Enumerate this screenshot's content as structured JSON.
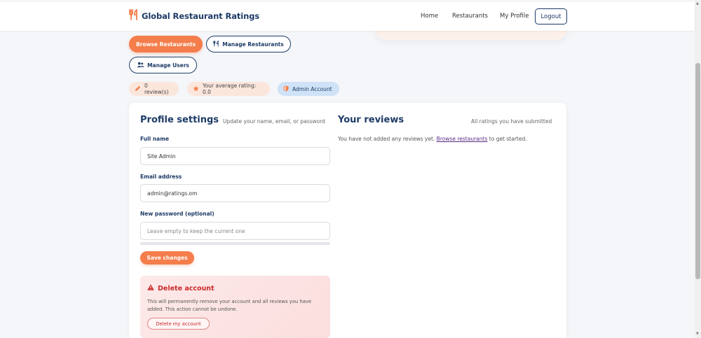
{
  "brand": {
    "title": "Global Restaurant Ratings",
    "accent": "#f47d4b",
    "navy": "#1d3b66"
  },
  "nav": {
    "home": "Home",
    "restaurants": "Restaurants",
    "my_profile": "My Profile",
    "logout": "Logout"
  },
  "actions": {
    "browse": "Browse Restaurants",
    "manage_restaurants": "Manage Restaurants",
    "manage_users": "Manage Users"
  },
  "stats": {
    "reviews": "0 review(s)",
    "average": "Your average rating: 0.0",
    "account": "Admin Account"
  },
  "profile": {
    "title": "Profile settings",
    "subtitle": "Update your name, email, or password",
    "full_name_label": "Full name",
    "full_name_value": "Site Admin",
    "email_label": "Email address",
    "email_value": "admin@ratings.om",
    "password_label": "New password (optional)",
    "password_placeholder": "Leave empty to keep the current one",
    "save_label": "Save changes"
  },
  "danger": {
    "title": "Delete account",
    "text": "This will permanently remove your account and all reviews you have added. This action cannot be undone.",
    "button": "Delete my account"
  },
  "reviews": {
    "title": "Your reviews",
    "subtitle": "All ratings you have submitted",
    "empty_before": "You have not added any reviews yet. ",
    "empty_link": "Browse restaurants",
    "empty_after": " to get started."
  }
}
